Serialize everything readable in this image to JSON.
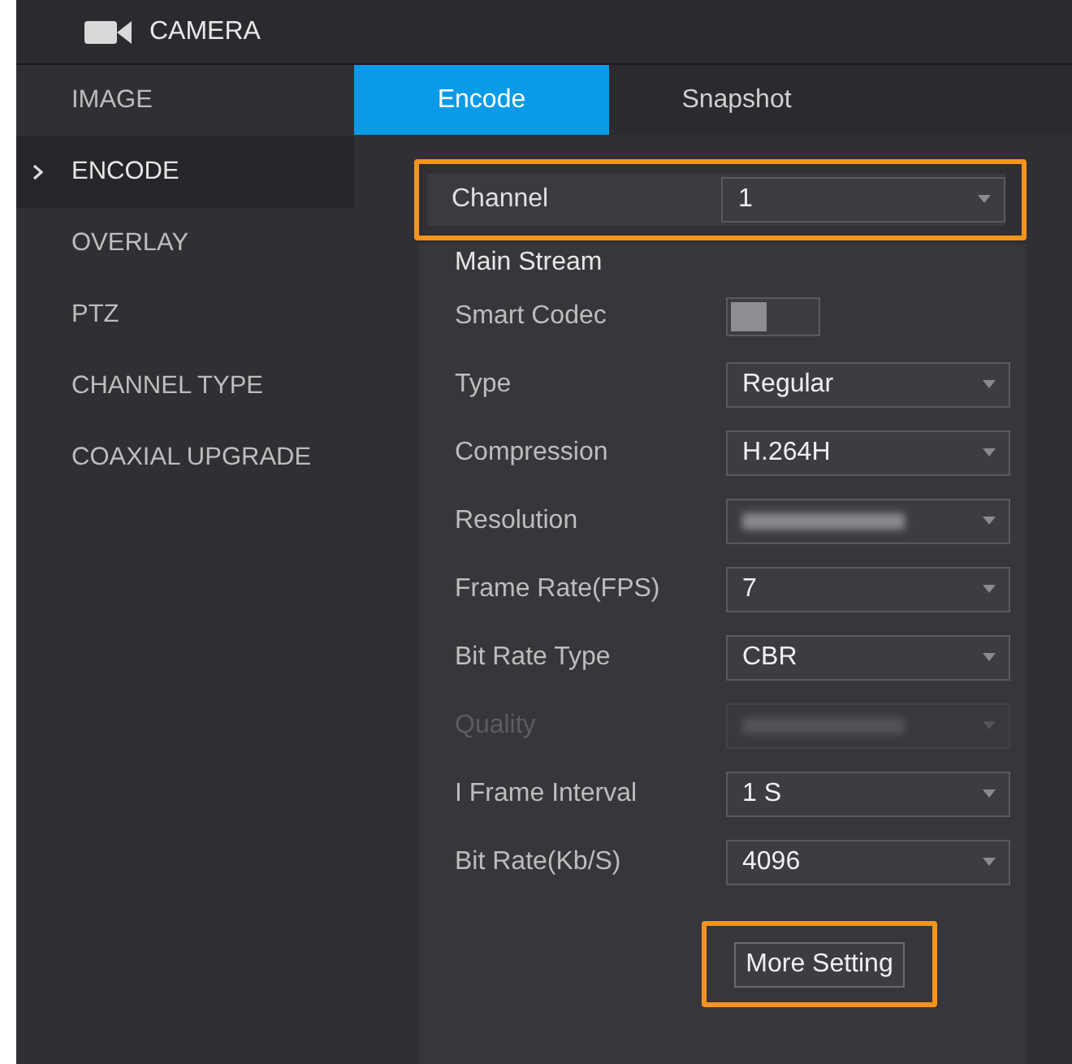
{
  "header": {
    "title": "CAMERA"
  },
  "sidebar": {
    "items": [
      {
        "label": "IMAGE",
        "selected": false
      },
      {
        "label": "ENCODE",
        "selected": true
      },
      {
        "label": "OVERLAY",
        "selected": false
      },
      {
        "label": "PTZ",
        "selected": false
      },
      {
        "label": "CHANNEL TYPE",
        "selected": false
      },
      {
        "label": "COAXIAL UPGRADE",
        "selected": false
      }
    ]
  },
  "tabs": [
    {
      "label": "Encode",
      "selected": true
    },
    {
      "label": "Snapshot",
      "selected": false
    }
  ],
  "channel": {
    "label": "Channel",
    "value": "1",
    "highlighted": true
  },
  "main_stream": {
    "title": "Main Stream",
    "settings": [
      {
        "kind": "toggle",
        "label": "Smart Codec",
        "on": false
      },
      {
        "kind": "select",
        "label": "Type",
        "value": "Regular",
        "disabled": false,
        "redacted": false
      },
      {
        "kind": "select",
        "label": "Compression",
        "value": "H.264H",
        "disabled": false,
        "redacted": false
      },
      {
        "kind": "select",
        "label": "Resolution",
        "disabled": false,
        "redacted": true
      },
      {
        "kind": "select",
        "label": "Frame Rate(FPS)",
        "value": "7",
        "disabled": false,
        "redacted": false
      },
      {
        "kind": "select",
        "label": "Bit Rate Type",
        "value": "CBR",
        "disabled": false,
        "redacted": false
      },
      {
        "kind": "select",
        "label": "Quality",
        "disabled": true,
        "redacted": true
      },
      {
        "kind": "select",
        "label": "I Frame Interval",
        "value": "1 S",
        "disabled": false,
        "redacted": false
      },
      {
        "kind": "select",
        "label": "Bit Rate(Kb/S)",
        "value": "4096",
        "disabled": false,
        "redacted": false
      }
    ]
  },
  "more_button": {
    "label": "More Setting",
    "highlighted": true
  }
}
